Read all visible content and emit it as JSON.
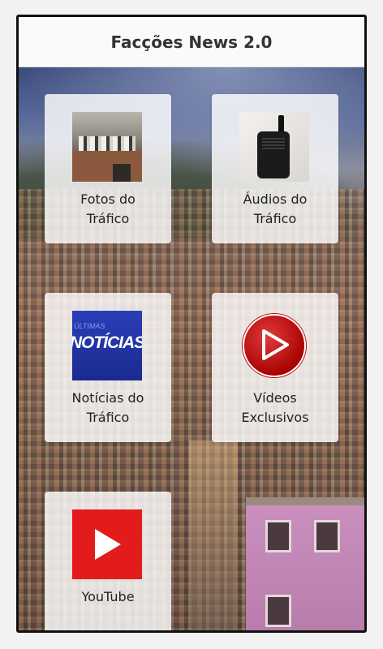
{
  "app": {
    "title": "Facções News 2.0"
  },
  "tiles": [
    {
      "label_line1": "Fotos do",
      "label_line2": "Tráfico",
      "icon": "favela-photo-thumbnail"
    },
    {
      "label_line1": "Áudios do",
      "label_line2": "Tráfico",
      "icon": "radio-thumbnail"
    },
    {
      "label_line1": "Notícias do",
      "label_line2": "Tráfico",
      "icon": "noticias-thumbnail",
      "thumb_text": "NOTÍCIAS",
      "thumb_small_text": "ÚLTIMAS"
    },
    {
      "label_line1": "Vídeos",
      "label_line2": "Exclusivos",
      "icon": "play-circle-icon"
    },
    {
      "label_line1": "YouTube",
      "label_line2": "",
      "icon": "youtube-icon"
    }
  ],
  "colors": {
    "accent_red": "#e41b1b",
    "title_text": "#333333"
  }
}
